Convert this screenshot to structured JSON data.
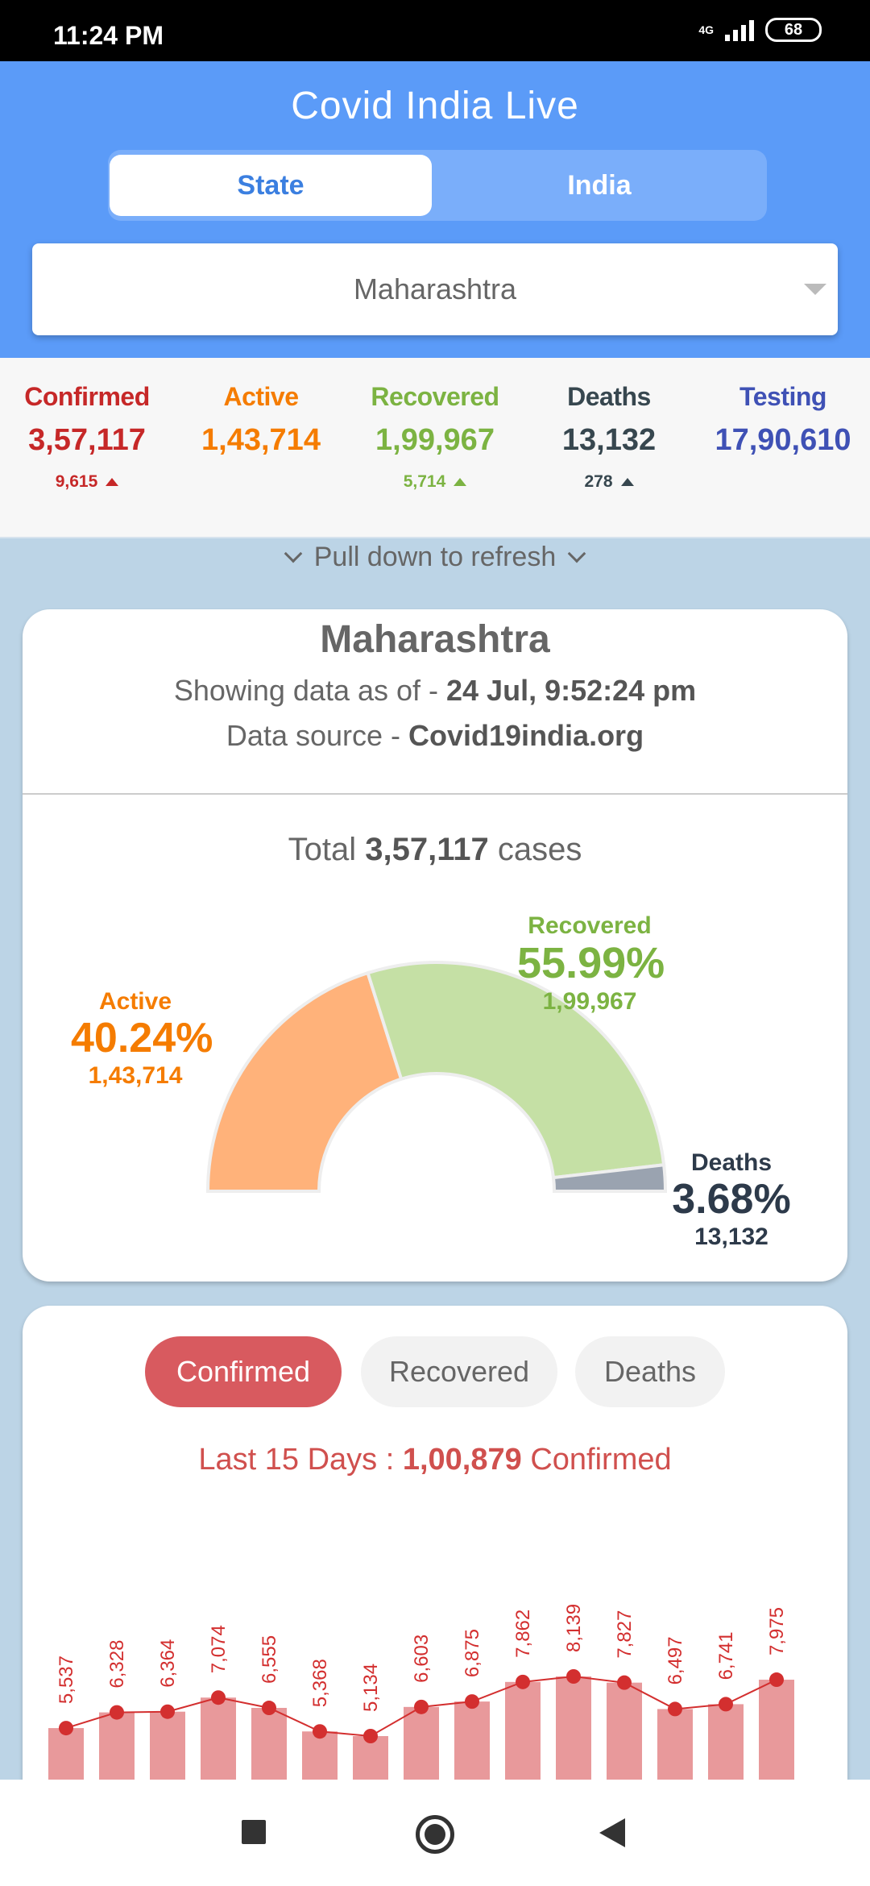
{
  "status_bar": {
    "time": "11:24 PM",
    "network": "4G",
    "battery": "68"
  },
  "app": {
    "title": "Covid India Live"
  },
  "tabs": [
    {
      "label": "State",
      "active": true
    },
    {
      "label": "India",
      "active": false
    }
  ],
  "state_selector": {
    "value": "Maharashtra"
  },
  "stats": [
    {
      "label": "Confirmed",
      "value": "3,57,117",
      "delta": "9,615",
      "color": "#c62828"
    },
    {
      "label": "Active",
      "value": "1,43,714",
      "delta": "",
      "color": "#f57c00"
    },
    {
      "label": "Recovered",
      "value": "1,99,967",
      "delta": "5,714",
      "color": "#7cb342"
    },
    {
      "label": "Deaths",
      "value": "13,132",
      "delta": "278",
      "color": "#37474f"
    },
    {
      "label": "Testing",
      "value": "17,90,610",
      "delta": "",
      "color": "#3f51b5"
    }
  ],
  "refresh_text": "Pull down to refresh",
  "summary_card": {
    "state": "Maharashtra",
    "asof_prefix": "Showing data as of - ",
    "asof_value": "24 Jul, 9:52:24 pm",
    "source_prefix": "Data source - ",
    "source_value": "Covid19india.org",
    "total_prefix": "Total ",
    "total_value": "3,57,117",
    "total_suffix": " cases"
  },
  "chart_data": [
    {
      "type": "pie",
      "variant": "half-donut",
      "slices": [
        {
          "label": "Active",
          "percent_label": "40.24%",
          "value_label": "1,43,714",
          "value": 143714,
          "color": "#f57c00",
          "fill": "#ffb27a"
        },
        {
          "label": "Recovered",
          "percent_label": "55.99%",
          "value_label": "1,99,967",
          "value": 199967,
          "color": "#7cb342",
          "fill": "#c5e0a5"
        },
        {
          "label": "Deaths",
          "percent_label": "3.68%",
          "value_label": "13,132",
          "value": 13132,
          "color": "#2d3a4a",
          "fill": "#9aa3b0"
        }
      ]
    },
    {
      "type": "bar",
      "categories": [
        "",
        "",
        "",
        "",
        "",
        "",
        "",
        "",
        "",
        "",
        "",
        "",
        "",
        "",
        ""
      ],
      "values": [
        5537,
        6328,
        6364,
        7074,
        6555,
        5368,
        5134,
        6603,
        6875,
        7862,
        8139,
        7827,
        6497,
        6741,
        7975
      ],
      "value_labels": [
        "5,537",
        "6,328",
        "6,364",
        "7,074",
        "6,555",
        "5,368",
        "5,134",
        "6,603",
        "6,875",
        "7,862",
        "8,139",
        "7,827",
        "6,497",
        "6,741",
        "7,975"
      ],
      "bar_color": "#e8999b",
      "line_color": "#d32f2f"
    }
  ],
  "trend_card": {
    "pills": [
      "Confirmed",
      "Recovered",
      "Deaths"
    ],
    "last15_prefix": "Last 15 Days : ",
    "last15_value": "1,00,879",
    "last15_suffix": " Confirmed"
  },
  "nav": {
    "icons": [
      "recents-icon",
      "home-icon",
      "back-icon"
    ]
  }
}
